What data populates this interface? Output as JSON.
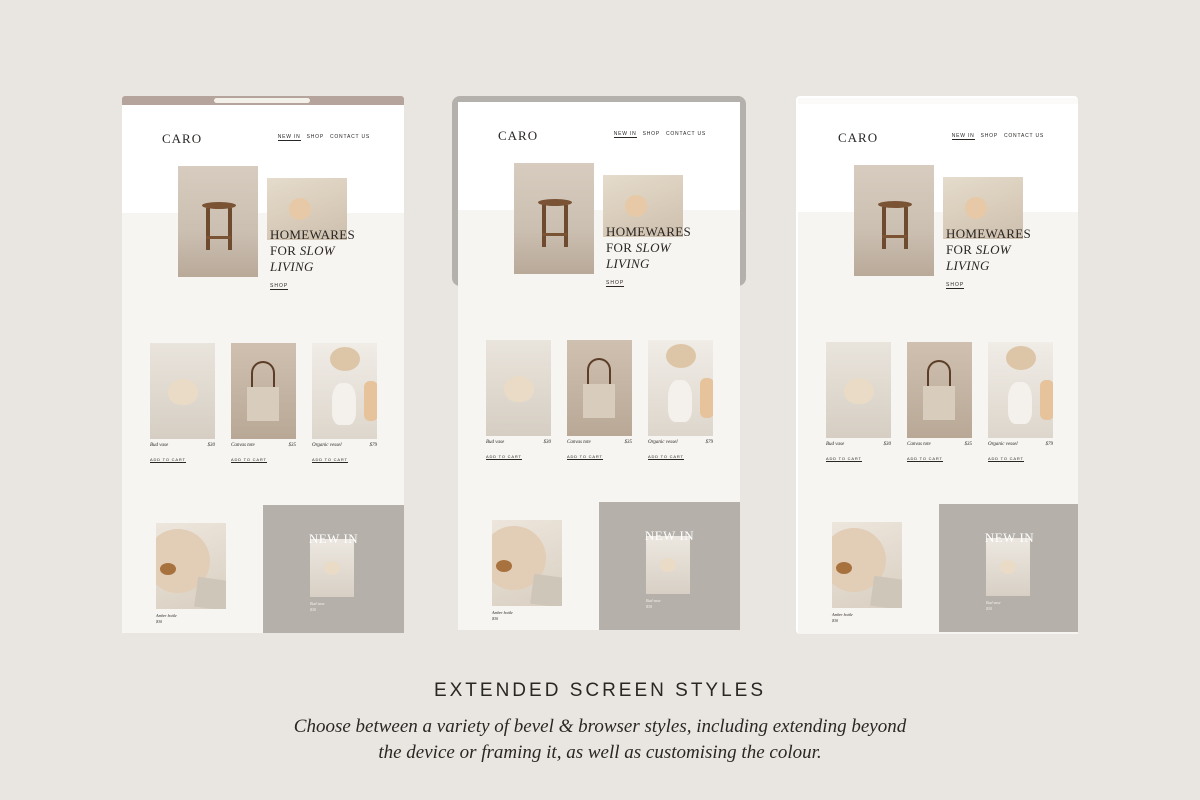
{
  "site": {
    "logo": "CARO",
    "nav": [
      "NEW IN",
      "SHOP",
      "CONTACT US"
    ],
    "hero": {
      "line1": "HOMEWARES",
      "line2_prefix": "FOR ",
      "line2_em": "SLOW",
      "line3_em": "LIVING",
      "cta": "SHOP"
    },
    "products": [
      {
        "name": "Bud vase",
        "price": "$30",
        "cta": "ADD TO CART"
      },
      {
        "name": "Canvas tote",
        "price": "$35",
        "cta": "ADD TO CART"
      },
      {
        "name": "Organic vessel",
        "price": "$79",
        "cta": "ADD TO CART"
      }
    ],
    "feature": {
      "name": "Amber bottle",
      "price": "$30"
    },
    "new_in": {
      "title": "NEW IN",
      "name": "Bud vase",
      "price": "$30"
    }
  },
  "screens": [
    {
      "id": "browser-tinted",
      "chrome_color": "#b5a49b"
    },
    {
      "id": "bevel-extended",
      "bevel_color": "#b4b1ac"
    },
    {
      "id": "browser-framed",
      "frame_color": "#ffffff"
    }
  ],
  "footer": {
    "heading": "EXTENDED SCREEN STYLES",
    "line1": "Choose between a variety of bevel & browser styles, including extending beyond",
    "line2": "the device or framing it, as well as customising the colour."
  }
}
